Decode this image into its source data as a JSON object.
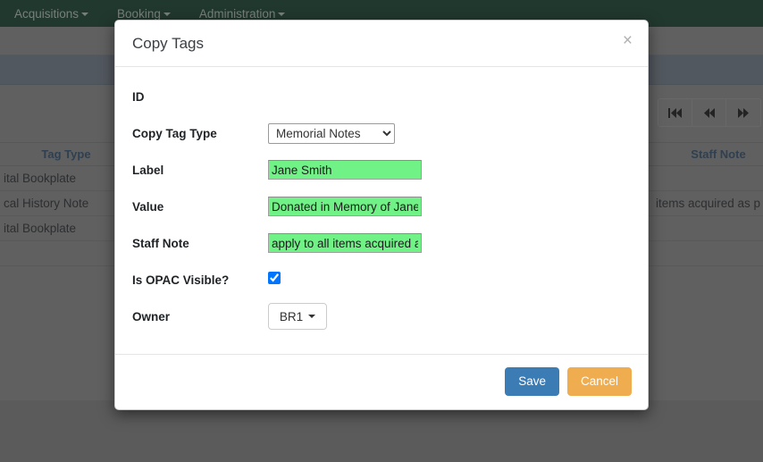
{
  "navbar": {
    "items": [
      {
        "label": "Acquisitions",
        "icon": "chevron-down-icon"
      },
      {
        "label": "Booking",
        "icon": "chevron-down-icon"
      },
      {
        "label": "Administration",
        "icon": "chevron-down-icon"
      }
    ]
  },
  "pager": {
    "first_label": "⏮",
    "prev_label": "◀◀",
    "next_label": "▶▶"
  },
  "records_table": {
    "headers": [
      "Tag Type",
      "Staff Note"
    ],
    "rows": [
      {
        "tag_type": "ital Bookplate",
        "staff_note": ""
      },
      {
        "tag_type": "cal History Note",
        "staff_note": "items acquired as p"
      },
      {
        "tag_type": "ital Bookplate",
        "staff_note": ""
      }
    ]
  },
  "modal": {
    "title": "Copy Tags",
    "close_label": "×",
    "fields": {
      "id_label": "ID",
      "id_value": "",
      "copy_tag_type_label": "Copy Tag Type",
      "copy_tag_type_value": "Memorial Notes",
      "label_label": "Label",
      "label_value": "Jane Smith",
      "value_label": "Value",
      "value_value": "Donated in Memory of Jane Smith",
      "staff_note_label": "Staff Note",
      "staff_note_value": "apply to all items acquired as part of this gift",
      "is_opac_visible_label": "Is OPAC Visible?",
      "owner_label": "Owner",
      "owner_value": "BR1"
    },
    "footer": {
      "save_label": "Save",
      "cancel_label": "Cancel"
    }
  },
  "colors": {
    "navbar_bg": "#0d3b27",
    "autofill_green": "#71f287",
    "save_blue": "#3b7cb5",
    "cancel_orange": "#efad4f",
    "backdrop_gray": "#808080"
  }
}
